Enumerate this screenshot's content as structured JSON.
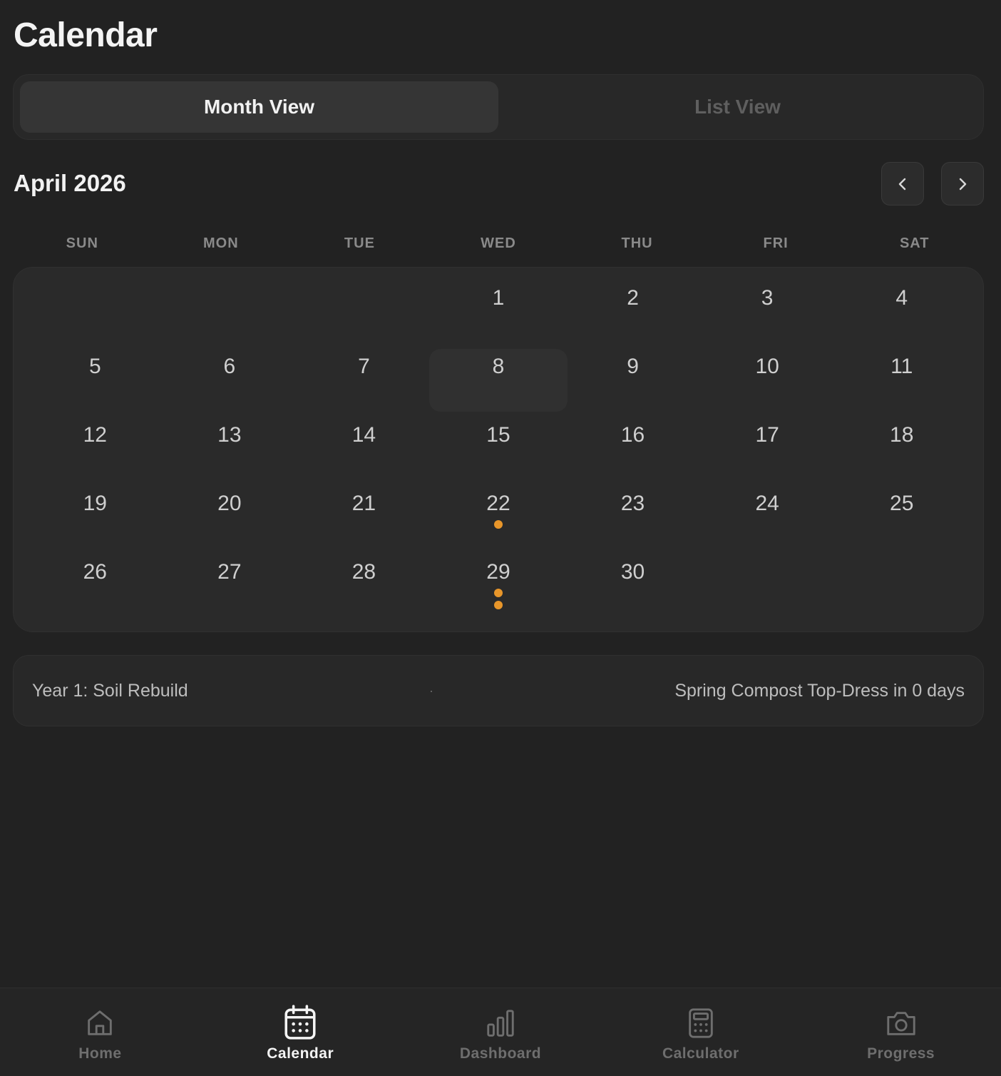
{
  "header": {
    "title": "Calendar"
  },
  "view_toggle": {
    "month_label": "Month View",
    "list_label": "List View",
    "active": "month"
  },
  "calendar": {
    "month_label": "April 2026",
    "weekdays": [
      "SUN",
      "MON",
      "TUE",
      "WED",
      "THU",
      "FRI",
      "SAT"
    ],
    "weeks": [
      [
        null,
        null,
        null,
        1,
        2,
        3,
        4
      ],
      [
        5,
        6,
        7,
        8,
        9,
        10,
        11
      ],
      [
        12,
        13,
        14,
        15,
        16,
        17,
        18
      ],
      [
        19,
        20,
        21,
        22,
        23,
        24,
        25
      ],
      [
        26,
        27,
        28,
        29,
        30,
        null,
        null
      ]
    ],
    "today": 8,
    "event_counts": {
      "22": 1,
      "29": 2
    },
    "event_color": "#e8962a"
  },
  "status": {
    "phase": "Year 1: Soil Rebuild",
    "separator": "·",
    "next_task": "Spring Compost Top-Dress in 0 days"
  },
  "tabbar": {
    "items": [
      {
        "id": "home",
        "label": "Home",
        "icon": "home-icon"
      },
      {
        "id": "calendar",
        "label": "Calendar",
        "icon": "calendar-icon"
      },
      {
        "id": "dashboard",
        "label": "Dashboard",
        "icon": "bar-chart-icon"
      },
      {
        "id": "calculator",
        "label": "Calculator",
        "icon": "calculator-icon"
      },
      {
        "id": "progress",
        "label": "Progress",
        "icon": "camera-icon"
      }
    ],
    "active": "calendar"
  }
}
